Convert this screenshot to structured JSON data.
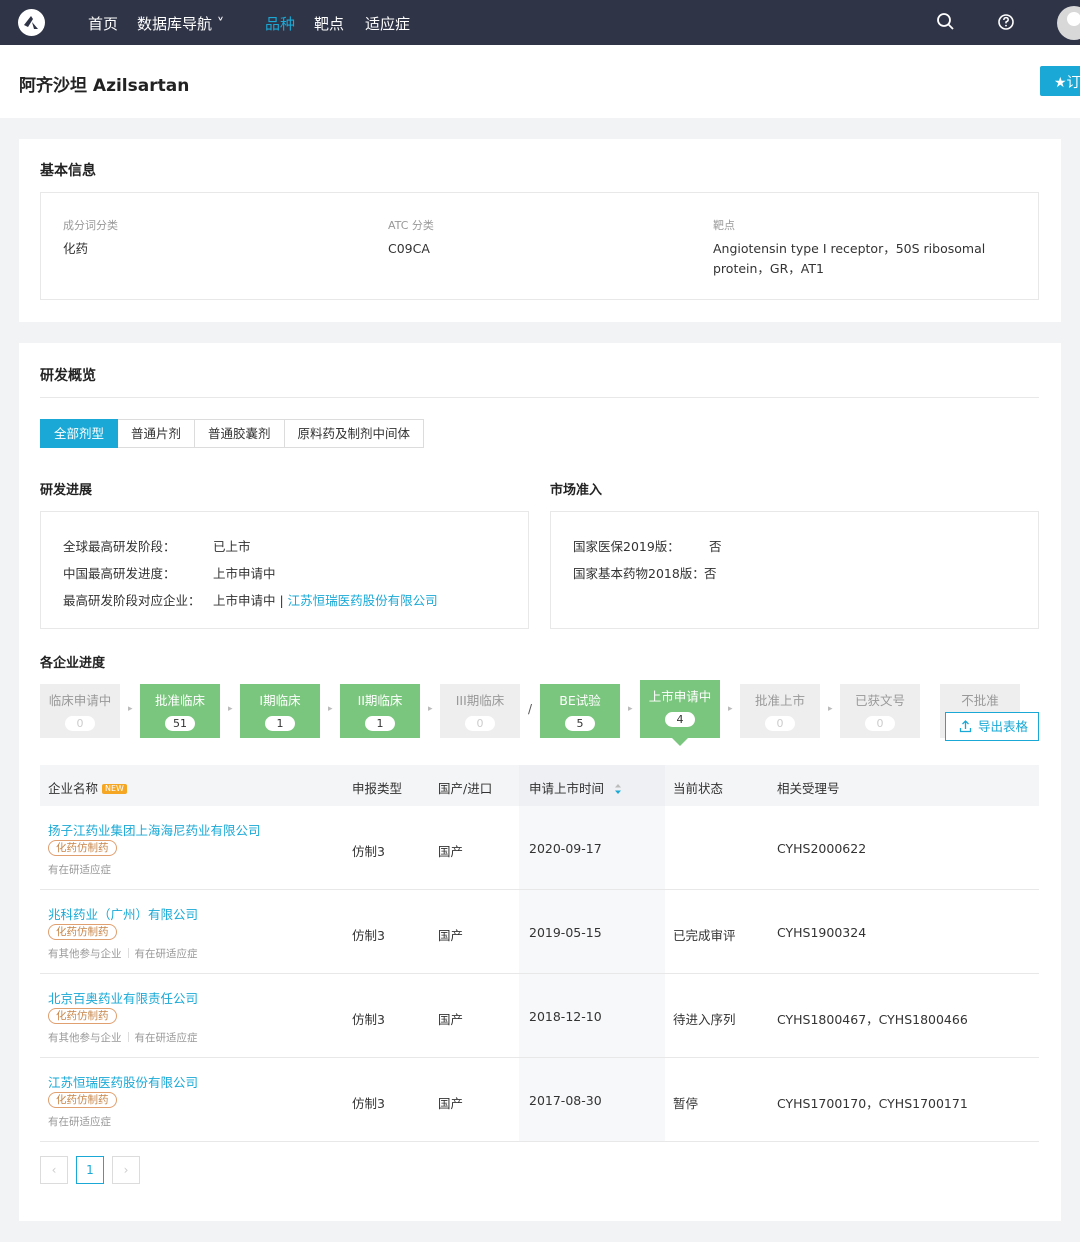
{
  "nav": {
    "items": [
      {
        "label": "首页",
        "active": false
      },
      {
        "label": "数据库导航 ˅",
        "active": false
      },
      {
        "label": "品种",
        "active": true
      },
      {
        "label": "靶点",
        "active": false
      },
      {
        "label": "适应症",
        "active": false
      }
    ]
  },
  "page": {
    "title": "阿齐沙坦 Azilsartan",
    "subscribe_label": "★订"
  },
  "basic": {
    "title": "基本信息",
    "fields": [
      {
        "label": "成分词分类",
        "value": "化药"
      },
      {
        "label": "ATC 分类",
        "value": "C09CA"
      },
      {
        "label": "靶点",
        "value": "Angiotensin type I receptor，50S ribosomal protein，GR，AT1"
      }
    ]
  },
  "rd": {
    "title": "研发概览",
    "tabs": [
      "全部剂型",
      "普通片剂",
      "普通胶囊剂",
      "原料药及制剂中间体"
    ],
    "progress_title": "研发进展",
    "progress": [
      {
        "key": "全球最高研发阶段：",
        "value": "已上市"
      },
      {
        "key": "中国最高研发进度：",
        "value": "上市申请中"
      },
      {
        "key": "最高研发阶段对应企业：",
        "value": "上市申请中 | ",
        "link": "江苏恒瑞医药股份有限公司"
      }
    ],
    "market_title": "市场准入",
    "market": [
      {
        "key": "国家医保2019版：",
        "value": "否"
      },
      {
        "key": "国家基本药物2018版：",
        "value": "否"
      }
    ],
    "pipeline_title": "各企业进度",
    "pipeline": [
      {
        "name": "临床申请中",
        "count": 0,
        "style": "grey"
      },
      {
        "name": "批准临床",
        "count": 51,
        "style": "green"
      },
      {
        "name": "I期临床",
        "count": 1,
        "style": "green"
      },
      {
        "name": "II期临床",
        "count": 1,
        "style": "green"
      },
      {
        "name": "III期临床",
        "count": 0,
        "style": "grey"
      },
      {
        "name": "BE试验",
        "count": 5,
        "style": "green"
      },
      {
        "name": "上市申请中",
        "count": 4,
        "style": "active"
      },
      {
        "name": "批准上市",
        "count": 0,
        "style": "grey"
      },
      {
        "name": "已获文号",
        "count": 0,
        "style": "grey"
      },
      {
        "name": "不批准",
        "count": "",
        "style": "grey"
      }
    ],
    "pipeline_separator": "/",
    "export_label": "导出表格"
  },
  "table": {
    "headers": {
      "company": "企业名称",
      "new_badge": "NEW",
      "type": "申报类型",
      "origin": "国产/进口",
      "date": "申请上市时间",
      "status": "当前状态",
      "number": "相关受理号"
    },
    "rows": [
      {
        "company": "扬子江药业集团上海海尼药业有限公司",
        "tag": "化药仿制药",
        "subs": [
          "有在研适应症"
        ],
        "type": "仿制3",
        "origin": "国产",
        "date": "2020-09-17",
        "status": "",
        "number": "CYHS2000622"
      },
      {
        "company": "兆科药业（广州）有限公司",
        "tag": "化药仿制药",
        "subs": [
          "有其他参与企业",
          "有在研适应症"
        ],
        "type": "仿制3",
        "origin": "国产",
        "date": "2019-05-15",
        "status": "已完成审评",
        "number": "CYHS1900324"
      },
      {
        "company": "北京百奥药业有限责任公司",
        "tag": "化药仿制药",
        "subs": [
          "有其他参与企业",
          "有在研适应症"
        ],
        "type": "仿制3",
        "origin": "国产",
        "date": "2018-12-10",
        "status": "待进入序列",
        "number": "CYHS1800467，CYHS1800466"
      },
      {
        "company": "江苏恒瑞医药股份有限公司",
        "tag": "化药仿制药",
        "subs": [
          "有在研适应症"
        ],
        "type": "仿制3",
        "origin": "国产",
        "date": "2017-08-30",
        "status": "暂停",
        "number": "CYHS1700170，CYHS1700171"
      }
    ]
  },
  "pager": {
    "prev": "‹",
    "current": "1",
    "next": "›"
  },
  "colors": {
    "nav_bg": "#2f3447",
    "accent": "#1aa9d6",
    "stage_green": "#7bc67e",
    "tag_orange": "#c8864a"
  }
}
